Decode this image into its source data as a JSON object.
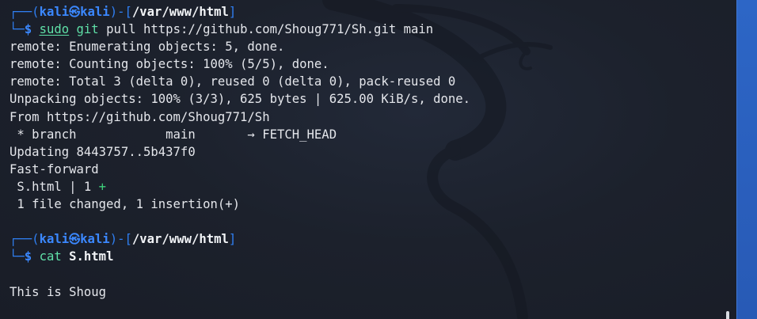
{
  "prompt1": {
    "corner_top": "┌──(",
    "user": "kali",
    "at_icon": "㉿",
    "host": "kali",
    "close_paren": ")-[",
    "path": "/var/www/html",
    "close_bracket": "]",
    "corner_bottom": "└─",
    "dollar": "$ ",
    "cmd_sudo": "sudo",
    "cmd_git": "git",
    "cmd_args": " pull https://github.com/Shoug771/Sh.git main"
  },
  "output": [
    "remote: Enumerating objects: 5, done.",
    "remote: Counting objects: 100% (5/5), done.",
    "remote: Total 3 (delta 0), reused 0 (delta 0), pack-reused 0",
    "Unpacking objects: 100% (3/3), 625 bytes | 625.00 KiB/s, done.",
    "From https://github.com/Shoug771/Sh",
    " * branch            main       → FETCH_HEAD",
    "Updating 8443757..5b437f0",
    "Fast-forward"
  ],
  "diffstat": {
    "file_line": " S.html | 1 ",
    "plus": "+",
    "summary": " 1 file changed, 1 insertion(+)"
  },
  "prompt2": {
    "corner_top": "┌──(",
    "user": "kali",
    "at_icon": "㉿",
    "host": "kali",
    "close_paren": ")-[",
    "path": "/var/www/html",
    "close_bracket": "]",
    "corner_bottom": "└─",
    "dollar": "$ ",
    "cmd": "cat",
    "arg": "S.html"
  },
  "cat_output": "This is Shoug",
  "colors": {
    "background": "#1c212c",
    "prompt_blue": "#2f7ff2",
    "command_green": "#5fe0a7",
    "insertion_green": "#3fd27c",
    "side_panel": "#2a5fbd"
  },
  "icons": {
    "background": "kali-dragon-watermark",
    "scrollbar": "scrollbar-thumb"
  }
}
